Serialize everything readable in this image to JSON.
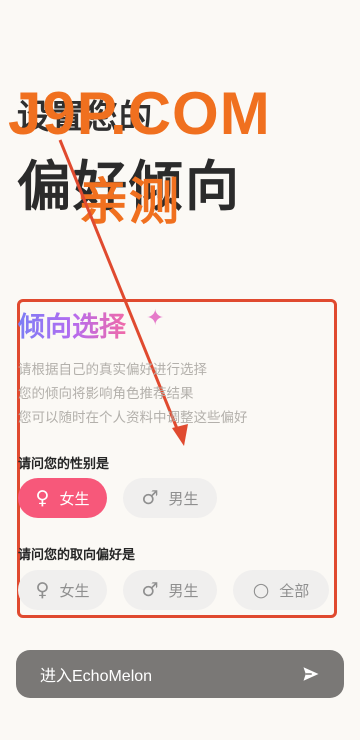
{
  "header": {
    "title_small": "设置您的",
    "title_big": "偏好倾向"
  },
  "watermark": {
    "main": "J9P.COM",
    "sub": "亲测"
  },
  "section": {
    "title": "倾向选择",
    "sparkle_icon": "sparkle-icon",
    "description": [
      "请根据自己的真实偏好进行选择",
      "您的倾向将影响角色推荐结果",
      "您可以随时在个人资料中调整这些偏好"
    ]
  },
  "gender": {
    "question": "请问您的性别是",
    "options": [
      {
        "label": "女生",
        "icon": "female-icon",
        "selected": true
      },
      {
        "label": "男生",
        "icon": "male-icon",
        "selected": false
      }
    ]
  },
  "orientation": {
    "question": "请问您的取向偏好是",
    "options": [
      {
        "label": "女生",
        "icon": "female-icon",
        "selected": false
      },
      {
        "label": "男生",
        "icon": "male-icon",
        "selected": false
      },
      {
        "label": "全部",
        "icon": "circle-icon",
        "selected": false
      }
    ]
  },
  "cta": {
    "label": "进入EchoMelon",
    "icon": "send-icon"
  },
  "colors": {
    "accent": "#f7587a",
    "annotation": "#e04a2f",
    "watermark": "#f0701f",
    "button": "#7a7876"
  }
}
